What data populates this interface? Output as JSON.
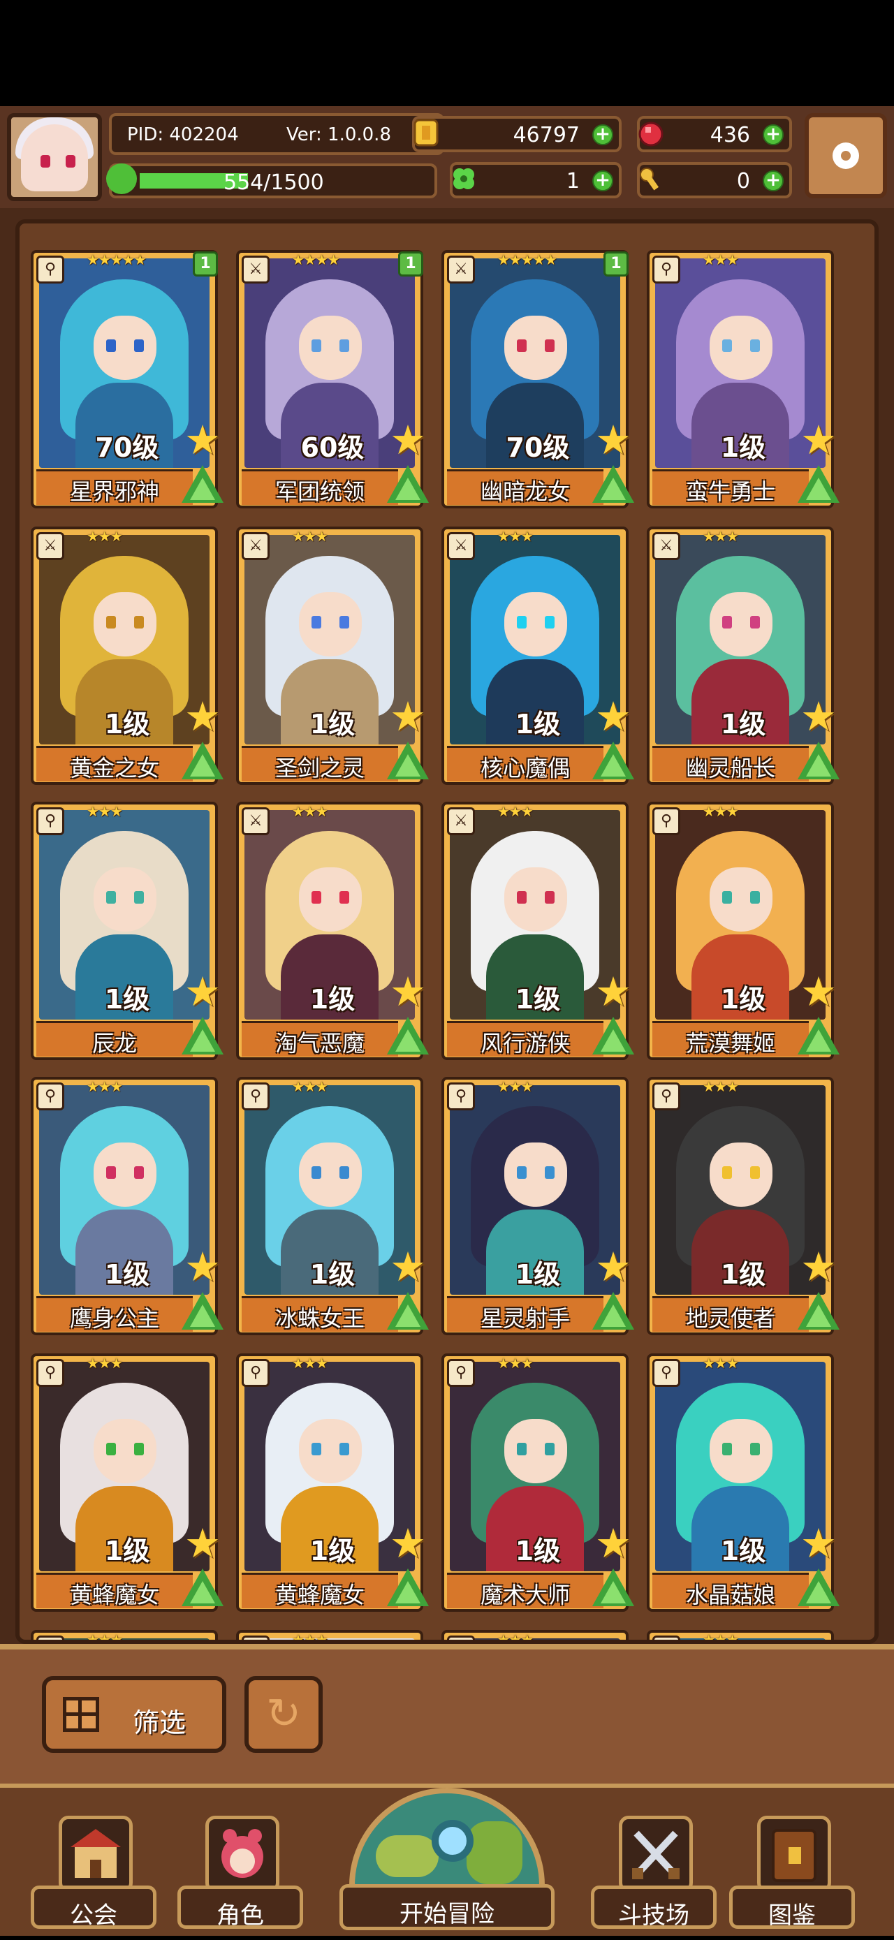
{
  "player": {
    "pid": "PID: 402204",
    "version": "Ver: 1.0.0.8",
    "xp": "554/1500",
    "xp_progress": 0.369
  },
  "resources": {
    "coins": "46797",
    "gems": "436",
    "clovers": "1",
    "keys": "0"
  },
  "roster": [
    {
      "name": "星界邪神",
      "level": "70级",
      "stars": "★★★★★",
      "badge": "1",
      "weapon": "⚲",
      "hair": "#3fb8d8",
      "outfit": "#2a6ea0",
      "bg": "#2f5f9a",
      "eye": "#2d64c8"
    },
    {
      "name": "军团统领",
      "level": "60级",
      "stars": "★★★★",
      "badge": "1",
      "weapon": "⚔",
      "hair": "#b7a8d8",
      "outfit": "#5a4a8a",
      "bg": "#4a3f7a",
      "eye": "#5e9ee0"
    },
    {
      "name": "幽暗龙女",
      "level": "70级",
      "stars": "★★★★★",
      "badge": "1",
      "weapon": "⚔",
      "hair": "#2b79b6",
      "outfit": "#1e3e5e",
      "bg": "#254a6f",
      "eye": "#d03050"
    },
    {
      "name": "蛮牛勇士",
      "level": "1级",
      "stars": "★★★",
      "badge": "",
      "weapon": "⚲",
      "hair": "#a58ad0",
      "outfit": "#6b4f8f",
      "bg": "#5a4f9a",
      "eye": "#6ab0e0"
    },
    {
      "name": "黄金之女",
      "level": "1级",
      "stars": "★★★",
      "badge": "",
      "weapon": "⚔",
      "hair": "#e0b43a",
      "outfit": "#b7862a",
      "bg": "#5e4120",
      "eye": "#c98a20"
    },
    {
      "name": "圣剑之灵",
      "level": "1级",
      "stars": "★★★",
      "badge": "",
      "weapon": "⚔",
      "hair": "#dfe6ef",
      "outfit": "#b79a70",
      "bg": "#6b5a4a",
      "eye": "#4a7ae0"
    },
    {
      "name": "核心魔偶",
      "level": "1级",
      "stars": "★★★",
      "badge": "",
      "weapon": "⚔",
      "hair": "#2aa7e0",
      "outfit": "#1e3a5a",
      "bg": "#1f4a5a",
      "eye": "#1fd0f0"
    },
    {
      "name": "幽灵船长",
      "level": "1级",
      "stars": "★★★",
      "badge": "",
      "weapon": "⚔",
      "hair": "#5bbf9f",
      "outfit": "#9a2a3a",
      "bg": "#3a4a5a",
      "eye": "#d04080"
    },
    {
      "name": "辰龙",
      "level": "1级",
      "stars": "★★★",
      "badge": "",
      "weapon": "⚲",
      "hair": "#e8dcc8",
      "outfit": "#2a7a9a",
      "bg": "#3a6a8a",
      "eye": "#3fb0a0"
    },
    {
      "name": "淘气恶魔",
      "level": "1级",
      "stars": "★★★",
      "badge": "",
      "weapon": "⚔",
      "hair": "#f0d08a",
      "outfit": "#5a2a3a",
      "bg": "#6a4a4a",
      "eye": "#e03050"
    },
    {
      "name": "风行游侠",
      "level": "1级",
      "stars": "★★★",
      "badge": "",
      "weapon": "⚔",
      "hair": "#f0f0f0",
      "outfit": "#2a5a3a",
      "bg": "#4a3a2a",
      "eye": "#d03050"
    },
    {
      "name": "荒漠舞姬",
      "level": "1级",
      "stars": "★★★",
      "badge": "",
      "weapon": "⚲",
      "hair": "#f2b050",
      "outfit": "#c84a2a",
      "bg": "#4a2a1e",
      "eye": "#3ab0a0"
    },
    {
      "name": "鹰身公主",
      "level": "1级",
      "stars": "★★★",
      "badge": "",
      "weapon": "⚲",
      "hair": "#5fd0e0",
      "outfit": "#6a7aa0",
      "bg": "#3a5a7a",
      "eye": "#d03060"
    },
    {
      "name": "冰蛛女王",
      "level": "1级",
      "stars": "★★★",
      "badge": "",
      "weapon": "⚲",
      "hair": "#6ad0e8",
      "outfit": "#4a6a7a",
      "bg": "#2f5a6a",
      "eye": "#3a8ad0"
    },
    {
      "name": "星灵射手",
      "level": "1级",
      "stars": "★★★",
      "badge": "",
      "weapon": "⚲",
      "hair": "#2a2a4a",
      "outfit": "#3aa0a0",
      "bg": "#2a3a5a",
      "eye": "#3a90d0"
    },
    {
      "name": "地灵使者",
      "level": "1级",
      "stars": "★★★",
      "badge": "",
      "weapon": "⚲",
      "hair": "#3a3a3a",
      "outfit": "#7a2a2a",
      "bg": "#2e2a2a",
      "eye": "#f0c030"
    },
    {
      "name": "黄蜂魔女",
      "level": "1级",
      "stars": "★★★",
      "badge": "",
      "weapon": "⚲",
      "hair": "#e8e0e0",
      "outfit": "#d88a20",
      "bg": "#3a2a2a",
      "eye": "#3ab040"
    },
    {
      "name": "黄蜂魔女",
      "level": "1级",
      "stars": "★★★",
      "badge": "",
      "weapon": "⚲",
      "hair": "#e8eef5",
      "outfit": "#e09a20",
      "bg": "#3a3040",
      "eye": "#3a9ad0"
    },
    {
      "name": "魔术大师",
      "level": "1级",
      "stars": "★★★",
      "badge": "",
      "weapon": "⚲",
      "hair": "#3a8a6a",
      "outfit": "#b02a3a",
      "bg": "#3a2a3a",
      "eye": "#30a0a0"
    },
    {
      "name": "水晶菇娘",
      "level": "1级",
      "stars": "★★★",
      "badge": "",
      "weapon": "⚲",
      "hair": "#3ad0c0",
      "outfit": "#2a7ab0",
      "bg": "#2a4a7a",
      "eye": "#3ab070"
    }
  ],
  "partial_row": [
    {
      "stars": "★★★",
      "weapon": "⚲",
      "bg": "#3a5a4a"
    },
    {
      "stars": "★★★",
      "weapon": "⚲",
      "bg": "#e0e0e0"
    },
    {
      "stars": "★★★",
      "weapon": "⚲",
      "bg": "#3a3a4a"
    },
    {
      "stars": "★★★",
      "weapon": "⚲",
      "bg": "#2a6a8a"
    }
  ],
  "filter": {
    "label": "筛选"
  },
  "nav": {
    "guild": "公会",
    "characters": "角色",
    "adventure": "开始冒险",
    "arena": "斗技场",
    "codex": "图鉴"
  },
  "colors": {
    "frame_brown": "#5a3422",
    "card_gold": "#f2b54a",
    "name_orange": "#d7772a",
    "upgrade_green": "#3fa33a",
    "star_yellow": "#ffd23a"
  }
}
